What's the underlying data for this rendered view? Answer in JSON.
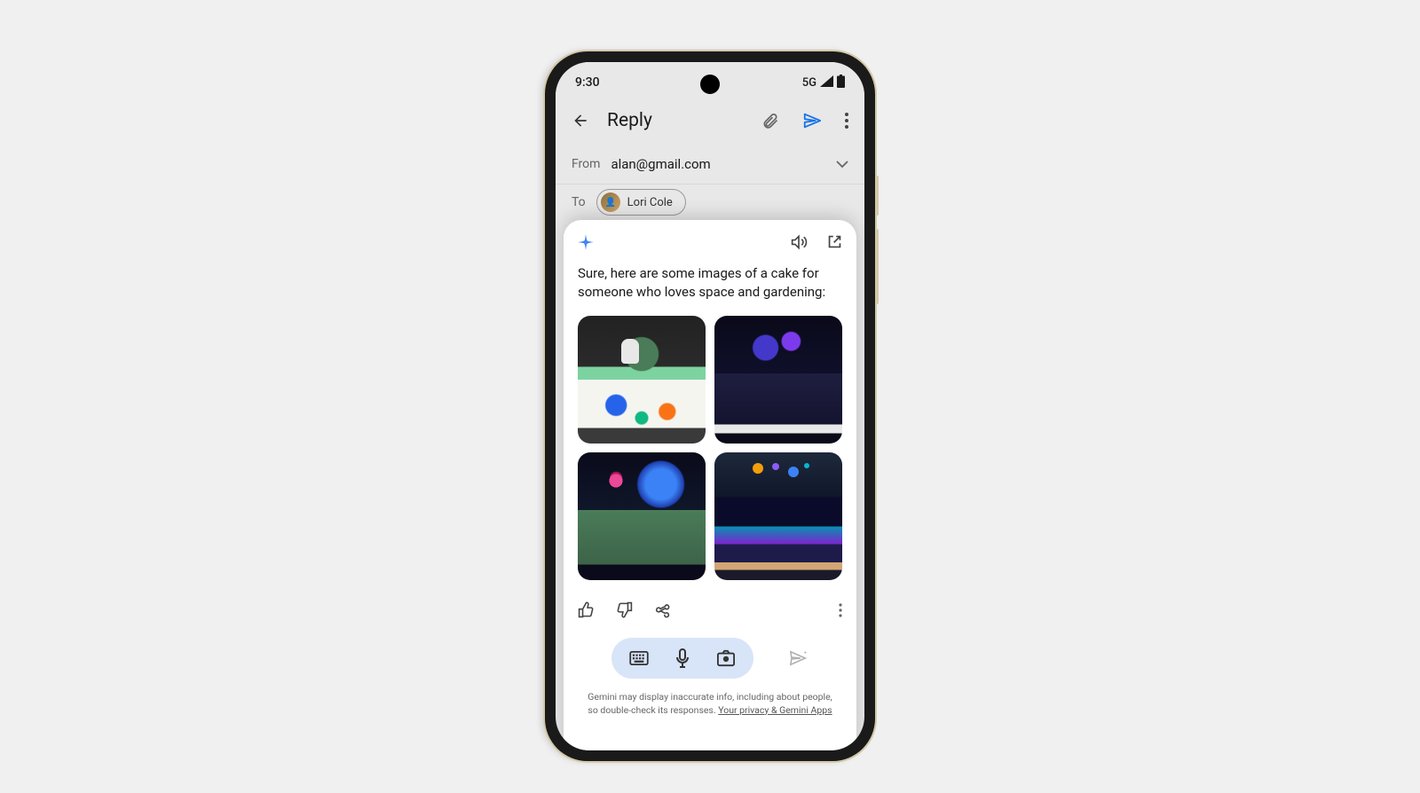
{
  "status": {
    "time": "9:30",
    "network": "5G"
  },
  "header": {
    "title": "Reply"
  },
  "from": {
    "label": "From",
    "value": "alan@gmail.com"
  },
  "to": {
    "label": "To",
    "chip_name": "Lori Cole"
  },
  "response": {
    "text": "Sure, here are some images of a cake for someone who loves space and gardening:"
  },
  "images": {
    "alt1": "White cake with green grass top, astronaut figure, small tree, and colorful planet dots",
    "alt2": "Dark navy cake with planets and cosmic dust on top on white plate",
    "alt3": "Green mossy cake with pink tree and glowing blue planet at night",
    "alt4": "Black galaxy cake with constellation lines and planets on sticks"
  },
  "disclaimer": {
    "line1": "Gemini may display inaccurate info, including about people,",
    "line2_prefix": "so double-check its responses. ",
    "link": "Your privacy & Gemini Apps"
  }
}
